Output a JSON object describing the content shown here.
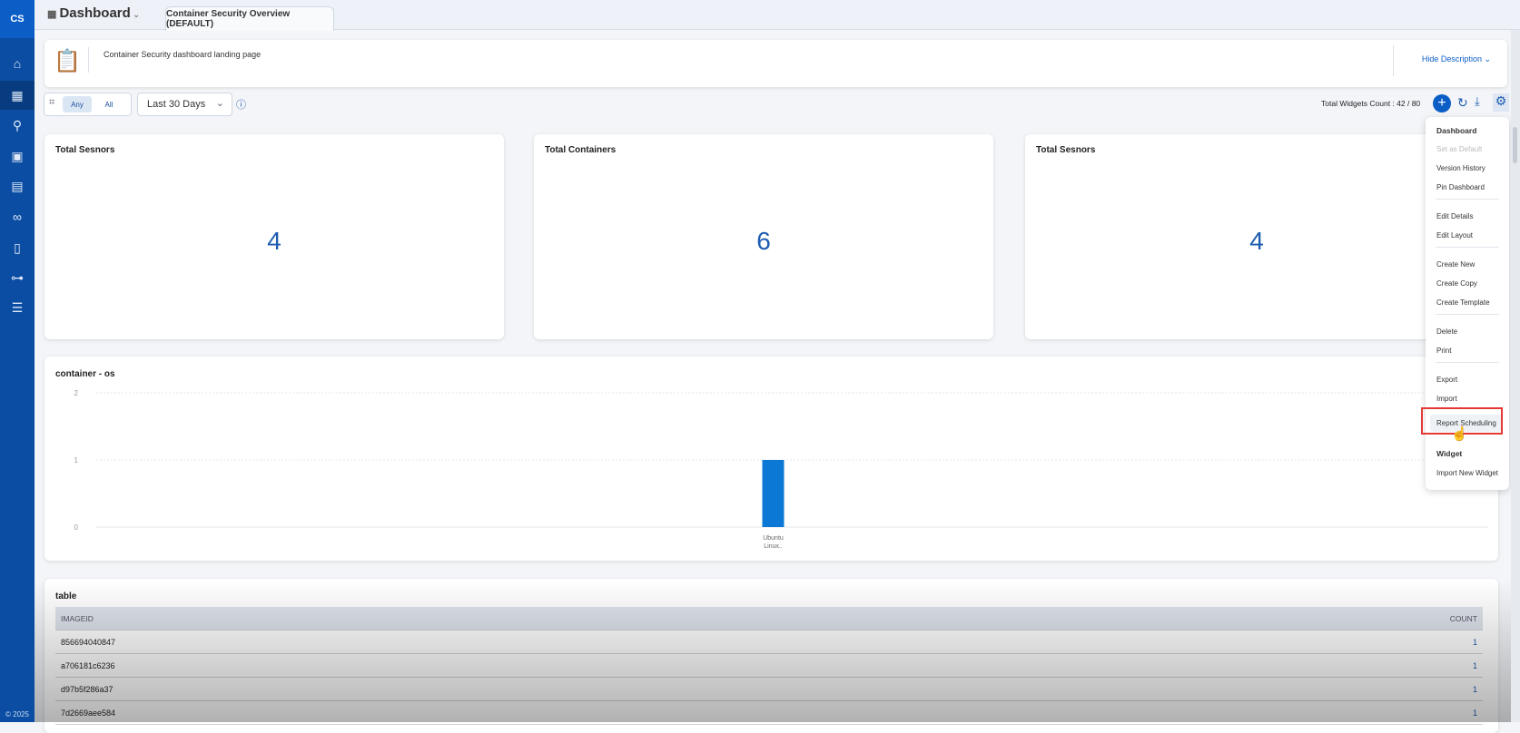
{
  "app": {
    "logo": "CS",
    "copyright": "© 2025"
  },
  "sidebar": {
    "items": [
      {
        "icon": "home-icon"
      },
      {
        "icon": "dashboard-icon"
      },
      {
        "icon": "network-icon"
      },
      {
        "icon": "assets-icon"
      },
      {
        "icon": "report-icon"
      },
      {
        "icon": "integrations-icon"
      },
      {
        "icon": "document-icon"
      },
      {
        "icon": "connector-icon"
      },
      {
        "icon": "settings-sliders-icon"
      }
    ]
  },
  "header": {
    "title": "Dashboard",
    "tab": "Container Security Overview (DEFAULT)"
  },
  "description": {
    "text": "Container Security dashboard landing page",
    "toggle": "Hide Description"
  },
  "toolbar": {
    "any": "Any",
    "all": "All",
    "range": "Last 30 Days",
    "widgets_count": "Total Widgets Count : 42 / 80"
  },
  "kpis": [
    {
      "title": "Total Sesnors",
      "value": "4"
    },
    {
      "title": "Total Containers",
      "value": "6"
    },
    {
      "title": "Total Sesnors",
      "value": "4"
    }
  ],
  "menu": {
    "dashboard_header": "Dashboard",
    "items_a": [
      "Set as Default",
      "Version History",
      "Pin Dashboard"
    ],
    "items_b": [
      "Edit Details",
      "Edit Layout"
    ],
    "items_c": [
      "Create New",
      "Create Copy",
      "Create Template"
    ],
    "items_d": [
      "Delete",
      "Print"
    ],
    "items_e": [
      "Export",
      "Import"
    ],
    "report": "Report Scheduling",
    "widget_header": "Widget",
    "import_widget": "Import New Widget"
  },
  "chart_data": {
    "type": "bar",
    "title": "container - os",
    "categories": [
      "Ubuntu Linux.."
    ],
    "values": [
      1
    ],
    "ylim": [
      0,
      2
    ],
    "yticks": [
      "0",
      "1",
      "2"
    ],
    "color": "#0a78d4"
  },
  "table": {
    "title": "table",
    "columns": [
      "IMAGEID",
      "COUNT"
    ],
    "rows": [
      [
        "856694040847",
        "1"
      ],
      [
        "a706181c6236",
        "1"
      ],
      [
        "d97b5f286a37",
        "1"
      ],
      [
        "7d2669aee584",
        "1"
      ]
    ]
  }
}
